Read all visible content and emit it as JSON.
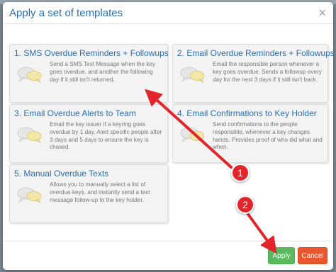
{
  "modal": {
    "title": "Apply a set of templates",
    "close_glyph": "×"
  },
  "templates": [
    {
      "title": "1. SMS Overdue Reminders + Followups",
      "description": "Send a SMS Text Message when the key goes overdue, and another the following day if it still isn't returned.",
      "icon": "message-bubbles-icon"
    },
    {
      "title": "2. Email Overdue Reminders + Followups",
      "description": "Email the responsible person whenever a key goes overdue. Sends a followup every day for the next 3 days if it still isn't back.",
      "icon": "message-bubbles-icon"
    },
    {
      "title": "3. Email Overdue Alerts to Team",
      "description": "Email the key issuer if a keyring goes overdue by 1 day. Alert specific people after 3 days and 5 days to ensure the key is chased.",
      "icon": "message-bubbles-icon"
    },
    {
      "title": "4. Email Confirmations to Key Holder",
      "description": "Send confirmations to the people responsible, whenever a key changes hands. Provides proof of who did what and when.",
      "icon": "message-bubbles-icon"
    },
    {
      "title": "5. Manual Overdue Texts",
      "description": "Allows you to manually select a list of overdue keys, and instantly send a text message follow-up to the key holder.",
      "icon": "message-bubbles-icon"
    }
  ],
  "footer": {
    "apply_label": "Apply",
    "cancel_label": "Cancel"
  },
  "annotations": {
    "marker_1": "1",
    "marker_2": "2",
    "color": "#e3242b"
  },
  "colors": {
    "title_blue": "#2a6fb5",
    "apply_green": "#5cb85c",
    "cancel_orange": "#e8582c"
  }
}
